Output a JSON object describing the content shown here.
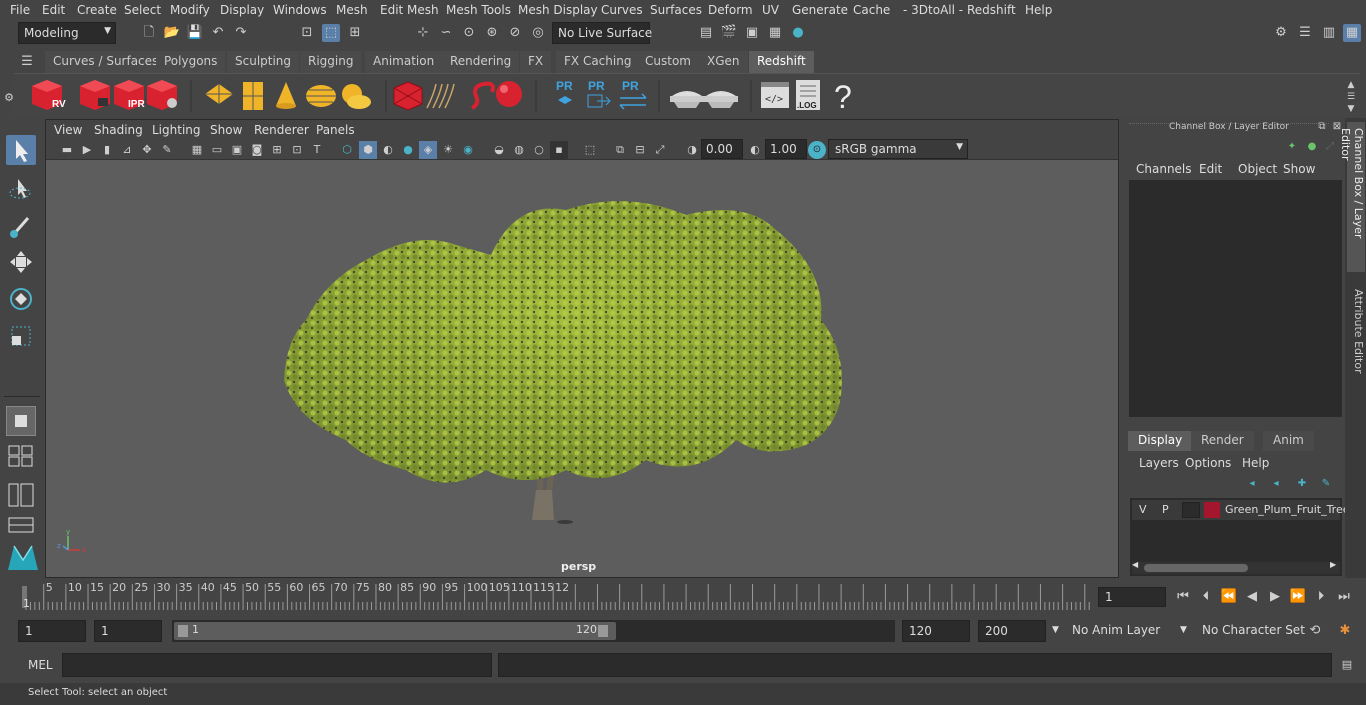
{
  "menubar": {
    "items": [
      "File",
      "Edit",
      "Create",
      "Select",
      "Modify",
      "Display",
      "Windows",
      "Mesh",
      "Edit Mesh",
      "Mesh Tools",
      "Mesh Display",
      "Curves",
      "Surfaces",
      "Deform",
      "UV",
      "Generate",
      "Cache",
      "- 3DtoAll -",
      "Redshift",
      "Help"
    ]
  },
  "statusline": {
    "mode": "Modeling",
    "live_surface": "No Live Surface"
  },
  "shelf_tabs": [
    "Curves / Surfaces",
    "Polygons",
    "Sculpting",
    "Rigging",
    "Animation",
    "Rendering",
    "FX",
    "FX Caching",
    "Custom",
    "XGen",
    "Redshift"
  ],
  "shelf_active_tab": "Redshift",
  "shelf": {
    "rv_label": "RV",
    "ipr_label": "IPR",
    "pr_label": "PR",
    "log_label": ".LOG",
    "help_label": "?"
  },
  "viewport": {
    "menu": [
      "View",
      "Shading",
      "Lighting",
      "Show",
      "Renderer",
      "Panels"
    ],
    "exposure": "0.00",
    "gamma": "1.00",
    "colorspace": "sRGB gamma",
    "camera_label": "persp",
    "axis_x": "x",
    "axis_y": "y",
    "axis_z": "z"
  },
  "channel_box": {
    "title": "Channel Box / Layer Editor",
    "menu": [
      "Channels",
      "Edit",
      "Object",
      "Show"
    ]
  },
  "layer_editor": {
    "tabs": [
      "Display",
      "Render",
      "Anim"
    ],
    "active_tab": "Display",
    "menu": [
      "Layers",
      "Options",
      "Help"
    ],
    "layer": {
      "v": "V",
      "p": "P",
      "name": "Green_Plum_Fruit_Tree",
      "color": "#a3162e"
    }
  },
  "side_tabs": [
    "Channel Box / Layer Editor",
    "Attribute Editor"
  ],
  "timeline": {
    "ticks": [
      "5",
      "10",
      "15",
      "20",
      "25",
      "30",
      "35",
      "40",
      "45",
      "50",
      "55",
      "60",
      "65",
      "70",
      "75",
      "80",
      "85",
      "90",
      "95",
      "100",
      "105",
      "110",
      "115",
      "12"
    ],
    "start_marker": "1",
    "current_frame": "1"
  },
  "range": {
    "start": "1",
    "playback_start": "1",
    "slider_start": "1",
    "slider_end": "120",
    "playback_end": "120",
    "end": "200",
    "anim_layer": "No Anim Layer",
    "character_set": "No Character Set"
  },
  "cmdline": {
    "lang": "MEL"
  },
  "helpline": {
    "text": "Select Tool: select an object"
  },
  "colors": {
    "maya_bg": "#444444",
    "viewport_bg": "#5d5d5d",
    "redshift_red": "#d9222f",
    "foliage": "#8ea832"
  }
}
